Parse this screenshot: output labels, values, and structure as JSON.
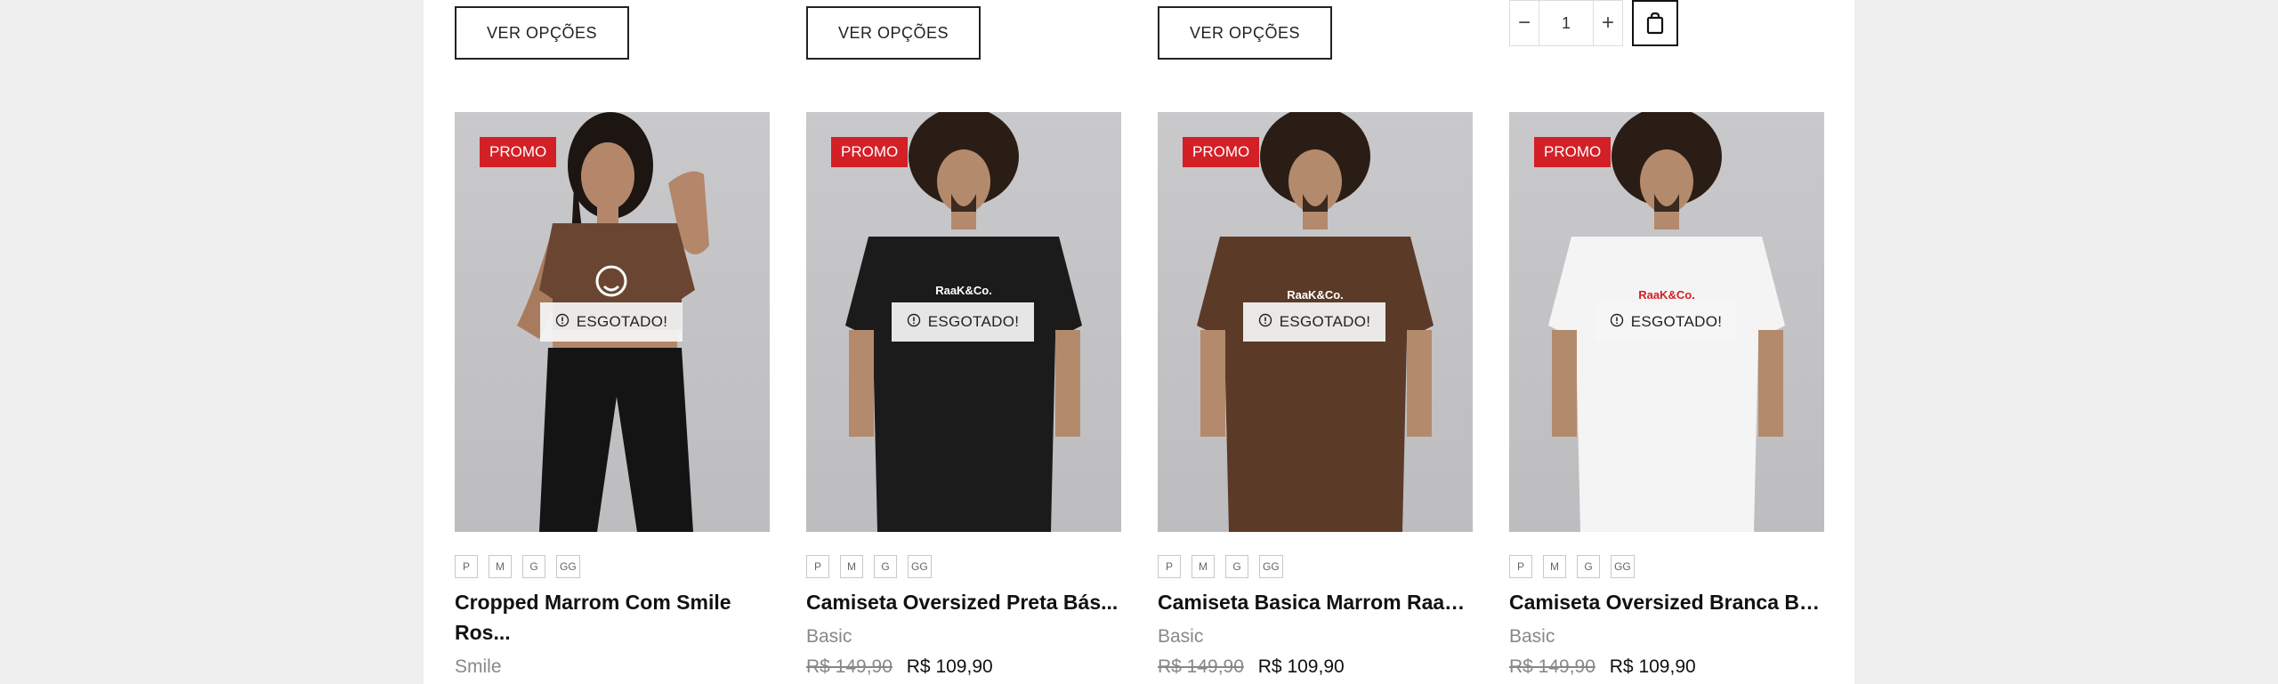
{
  "top_actions": {
    "view_options_label": "VER OPÇÕES",
    "quantity_value": "1"
  },
  "products": [
    {
      "promo": "PROMO",
      "status": "ESGOTADO!",
      "sizes": [
        "P",
        "M",
        "G",
        "GG"
      ],
      "title": "Cropped Marrom Com Smile Ros...",
      "brand": "Smile",
      "old_price": "",
      "price": "",
      "shirt_color": "#6a4632",
      "logo": ""
    },
    {
      "promo": "PROMO",
      "status": "ESGOTADO!",
      "sizes": [
        "P",
        "M",
        "G",
        "GG"
      ],
      "title": "Camiseta Oversized Preta Bás...",
      "brand": "Basic",
      "old_price": "R$ 149,90",
      "price": "R$ 109,90",
      "shirt_color": "#1b1b1b",
      "logo": "RaaK&Co."
    },
    {
      "promo": "PROMO",
      "status": "ESGOTADO!",
      "sizes": [
        "P",
        "M",
        "G",
        "GG"
      ],
      "title": "Camiseta Basica Marrom RaakC...",
      "brand": "Basic",
      "old_price": "R$ 149,90",
      "price": "R$ 109,90",
      "shirt_color": "#5b3a28",
      "logo": "RaaK&Co."
    },
    {
      "promo": "PROMO",
      "status": "ESGOTADO!",
      "sizes": [
        "P",
        "M",
        "G",
        "GG"
      ],
      "title": "Camiseta Oversized Branca Bá...",
      "brand": "Basic",
      "old_price": "R$ 149,90",
      "price": "R$ 109,90",
      "shirt_color": "#f4f4f4",
      "logo": "RaaK&Co."
    }
  ]
}
